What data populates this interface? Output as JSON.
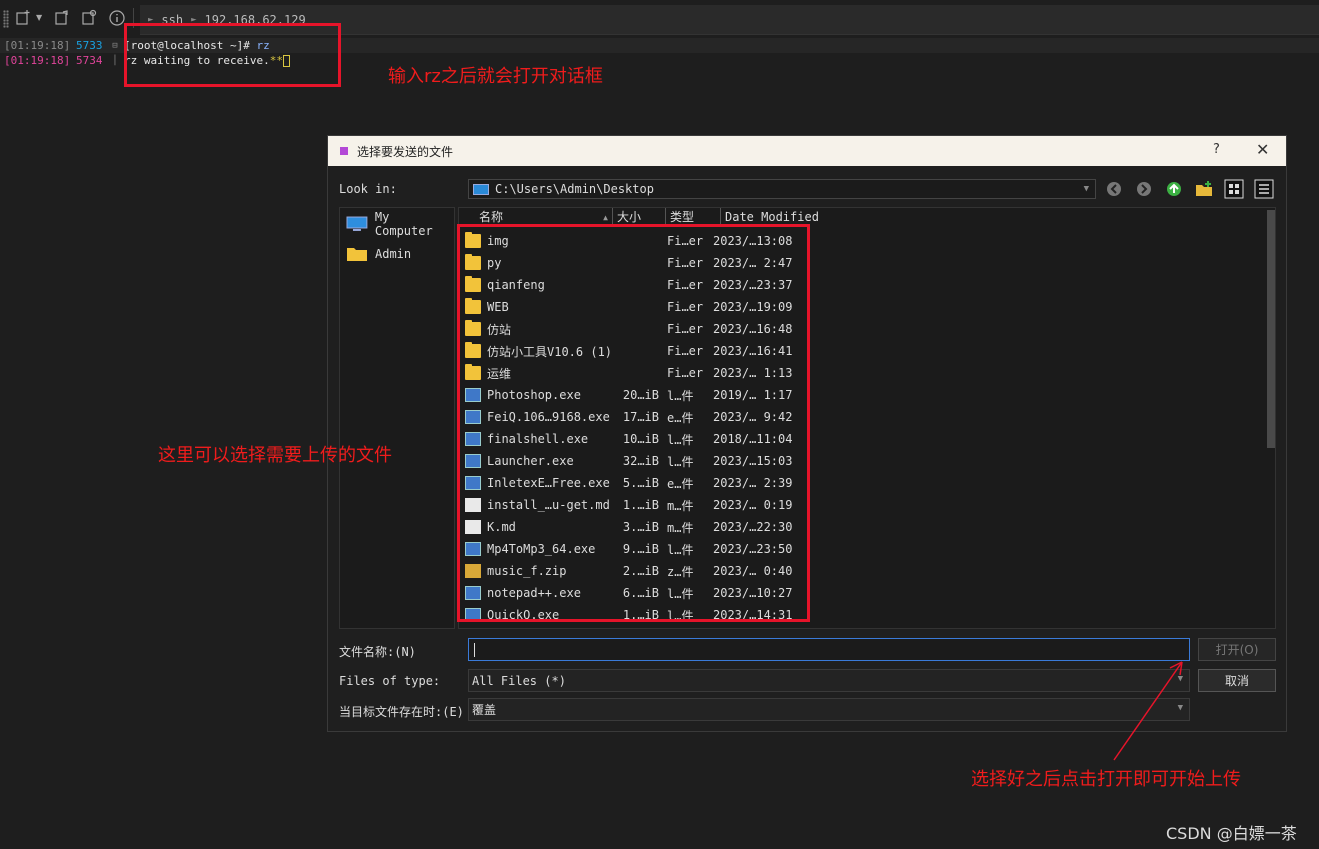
{
  "toolbar": {
    "crumbs": [
      "ssh",
      "192.168.62.129"
    ]
  },
  "terminal": {
    "lines": [
      {
        "time": "[01:19:18]",
        "pid": "5733",
        "prompt": "[root@localhost ~]",
        "hash": "#",
        "cmd": "rz"
      },
      {
        "time": "[01:19:18]",
        "pid": "5734",
        "text": "rz waiting to receive.",
        "stars": "**"
      }
    ]
  },
  "annotations": {
    "note1": "输入rz之后就会打开对话框",
    "note2": "这里可以选择需要上传的文件",
    "note3": "选择好之后点击打开即可开始上传",
    "color": "#e6142a"
  },
  "dialog": {
    "title": "选择要发送的文件",
    "help": "?",
    "close": "✕",
    "look_in_label": "Look in:",
    "path": "C:\\Users\\Admin\\Desktop",
    "sidebar": [
      {
        "label": "My Computer",
        "icon": "computer-icon"
      },
      {
        "label": "Admin",
        "icon": "folder-icon"
      }
    ],
    "columns": [
      "名称",
      "大小",
      "类型",
      "Date Modified"
    ],
    "files": [
      {
        "name": "img",
        "size": "",
        "type": "Fi…er",
        "date": "2023/…13:08",
        "icon": "folder"
      },
      {
        "name": "py",
        "size": "",
        "type": "Fi…er",
        "date": "2023/… 2:47",
        "icon": "folder"
      },
      {
        "name": "qianfeng",
        "size": "",
        "type": "Fi…er",
        "date": "2023/…23:37",
        "icon": "folder"
      },
      {
        "name": "WEB",
        "size": "",
        "type": "Fi…er",
        "date": "2023/…19:09",
        "icon": "folder"
      },
      {
        "name": "仿站",
        "size": "",
        "type": "Fi…er",
        "date": "2023/…16:48",
        "icon": "folder"
      },
      {
        "name": "仿站小工具V10.6 (1)",
        "size": "",
        "type": "Fi…er",
        "date": "2023/…16:41",
        "icon": "folder"
      },
      {
        "name": "运维",
        "size": "",
        "type": "Fi…er",
        "date": "2023/… 1:13",
        "icon": "folder"
      },
      {
        "name": "Photoshop.exe",
        "size": "20…iB",
        "type": "l…件",
        "date": "2019/… 1:17",
        "icon": "exe"
      },
      {
        "name": "FeiQ.106…9168.exe",
        "size": "17…iB",
        "type": "e…件",
        "date": "2023/… 9:42",
        "icon": "exe"
      },
      {
        "name": "finalshell.exe",
        "size": "10…iB",
        "type": "l…件",
        "date": "2018/…11:04",
        "icon": "exe"
      },
      {
        "name": "Launcher.exe",
        "size": "32…iB",
        "type": "l…件",
        "date": "2023/…15:03",
        "icon": "exe"
      },
      {
        "name": "InletexE…Free.exe",
        "size": "5.…iB",
        "type": "e…件",
        "date": "2023/… 2:39",
        "icon": "exe"
      },
      {
        "name": "install_…u-get.md",
        "size": "1.…iB",
        "type": "m…件",
        "date": "2023/… 0:19",
        "icon": "doc"
      },
      {
        "name": "K.md",
        "size": "3.…iB",
        "type": "m…件",
        "date": "2023/…22:30",
        "icon": "doc"
      },
      {
        "name": "Mp4ToMp3_64.exe",
        "size": "9.…iB",
        "type": "l…件",
        "date": "2023/…23:50",
        "icon": "exe"
      },
      {
        "name": "music_f.zip",
        "size": "2.…iB",
        "type": "z…件",
        "date": "2023/… 0:40",
        "icon": "zip"
      },
      {
        "name": "notepad++.exe",
        "size": "6.…iB",
        "type": "l…件",
        "date": "2023/…10:27",
        "icon": "exe"
      },
      {
        "name": "QuickQ.exe",
        "size": "1.…iB",
        "type": "l…件",
        "date": "2023/…14:31",
        "icon": "exe"
      }
    ],
    "filename_label": "文件名称:(N)",
    "filename_value": "",
    "filetype_label": "Files of type:",
    "filetype_value": "All Files (*)",
    "exists_label": "当目标文件存在时:(E)",
    "exists_value": "覆盖",
    "open_button": "打开(O)",
    "cancel_button": "取消"
  },
  "watermark": "CSDN @白嫖一茶"
}
